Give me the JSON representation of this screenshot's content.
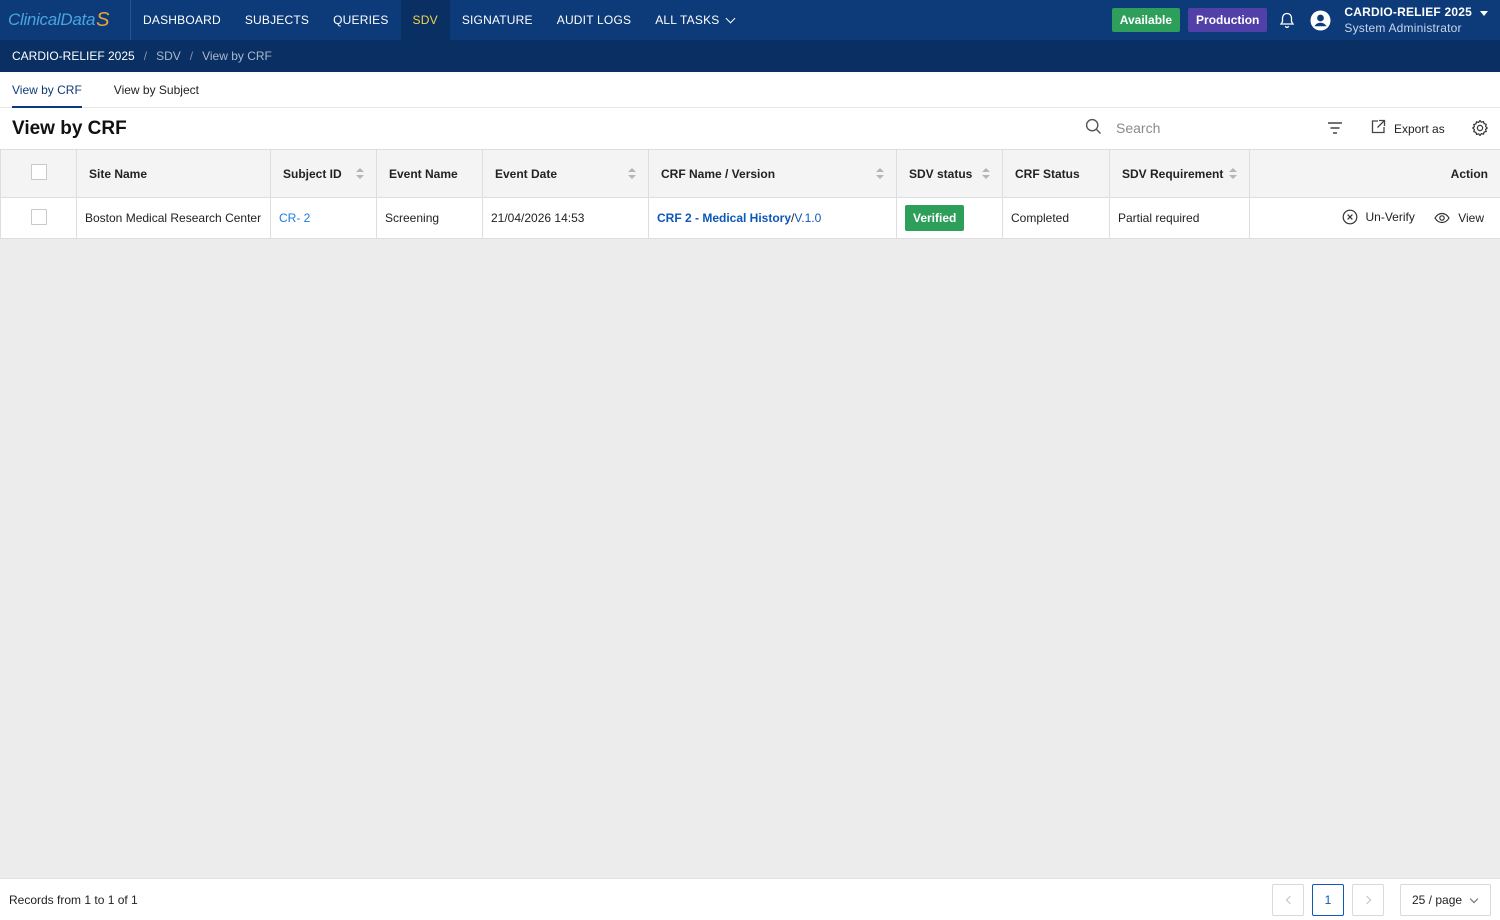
{
  "app": {
    "logo_text": "ClinicalData",
    "logo_mark": "S"
  },
  "nav": {
    "items": [
      {
        "label": "DASHBOARD"
      },
      {
        "label": "SUBJECTS"
      },
      {
        "label": "QUERIES"
      },
      {
        "label": "SDV",
        "active": true
      },
      {
        "label": "SIGNATURE"
      },
      {
        "label": "AUDIT LOGS"
      },
      {
        "label": "ALL TASKS",
        "dropdown": true
      }
    ],
    "status_badge": "Available",
    "env_badge": "Production",
    "study_name": "CARDIO-RELIEF 2025",
    "user_role": "System Administrator",
    "icons": [
      "bell-icon",
      "user-avatar-icon",
      "caret-down-icon"
    ]
  },
  "breadcrumb": {
    "items": [
      "CARDIO-RELIEF 2025",
      "SDV",
      "View by CRF"
    ],
    "separator": "/"
  },
  "subtabs": {
    "items": [
      {
        "label": "View by CRF",
        "active": true
      },
      {
        "label": "View by Subject"
      }
    ]
  },
  "toolbar": {
    "title": "View by CRF",
    "search_placeholder": "Search",
    "export_label": "Export as"
  },
  "table": {
    "columns": [
      {
        "label": "",
        "type": "checkbox"
      },
      {
        "label": "Site Name"
      },
      {
        "label": "Subject ID",
        "sortable": true
      },
      {
        "label": "Event Name"
      },
      {
        "label": "Event Date",
        "sortable": true
      },
      {
        "label": "CRF Name / Version",
        "sortable": true
      },
      {
        "label": "SDV status",
        "sortable": true
      },
      {
        "label": "CRF Status"
      },
      {
        "label": "SDV Requirement",
        "sortable": true
      },
      {
        "label": "Action"
      }
    ],
    "rows": [
      {
        "site_name": "Boston Medical Research Center",
        "subject_id": "CR- 2",
        "event_name": "Screening",
        "event_date": "21/04/2026 14:53",
        "crf_name": "CRF 2 - Medical History",
        "crf_sep": "/",
        "crf_version": "V.1.0",
        "sdv_status": "Verified",
        "crf_status": "Completed",
        "sdv_requirement": "Partial required",
        "actions": [
          {
            "label": "Un-Verify",
            "icon": "x-circle-icon"
          },
          {
            "label": "View",
            "icon": "eye-icon"
          }
        ]
      }
    ]
  },
  "footer": {
    "records_text": "Records from 1 to 1 of 1",
    "current_page": "1",
    "page_size": "25 / page"
  },
  "colors": {
    "nav_bg": "#0d3b7a",
    "nav_active_text": "#f0d54a",
    "available": "#2e9e5b",
    "production": "#5140a8",
    "link": "#1c7ee0",
    "verified": "#2e9e5b"
  }
}
